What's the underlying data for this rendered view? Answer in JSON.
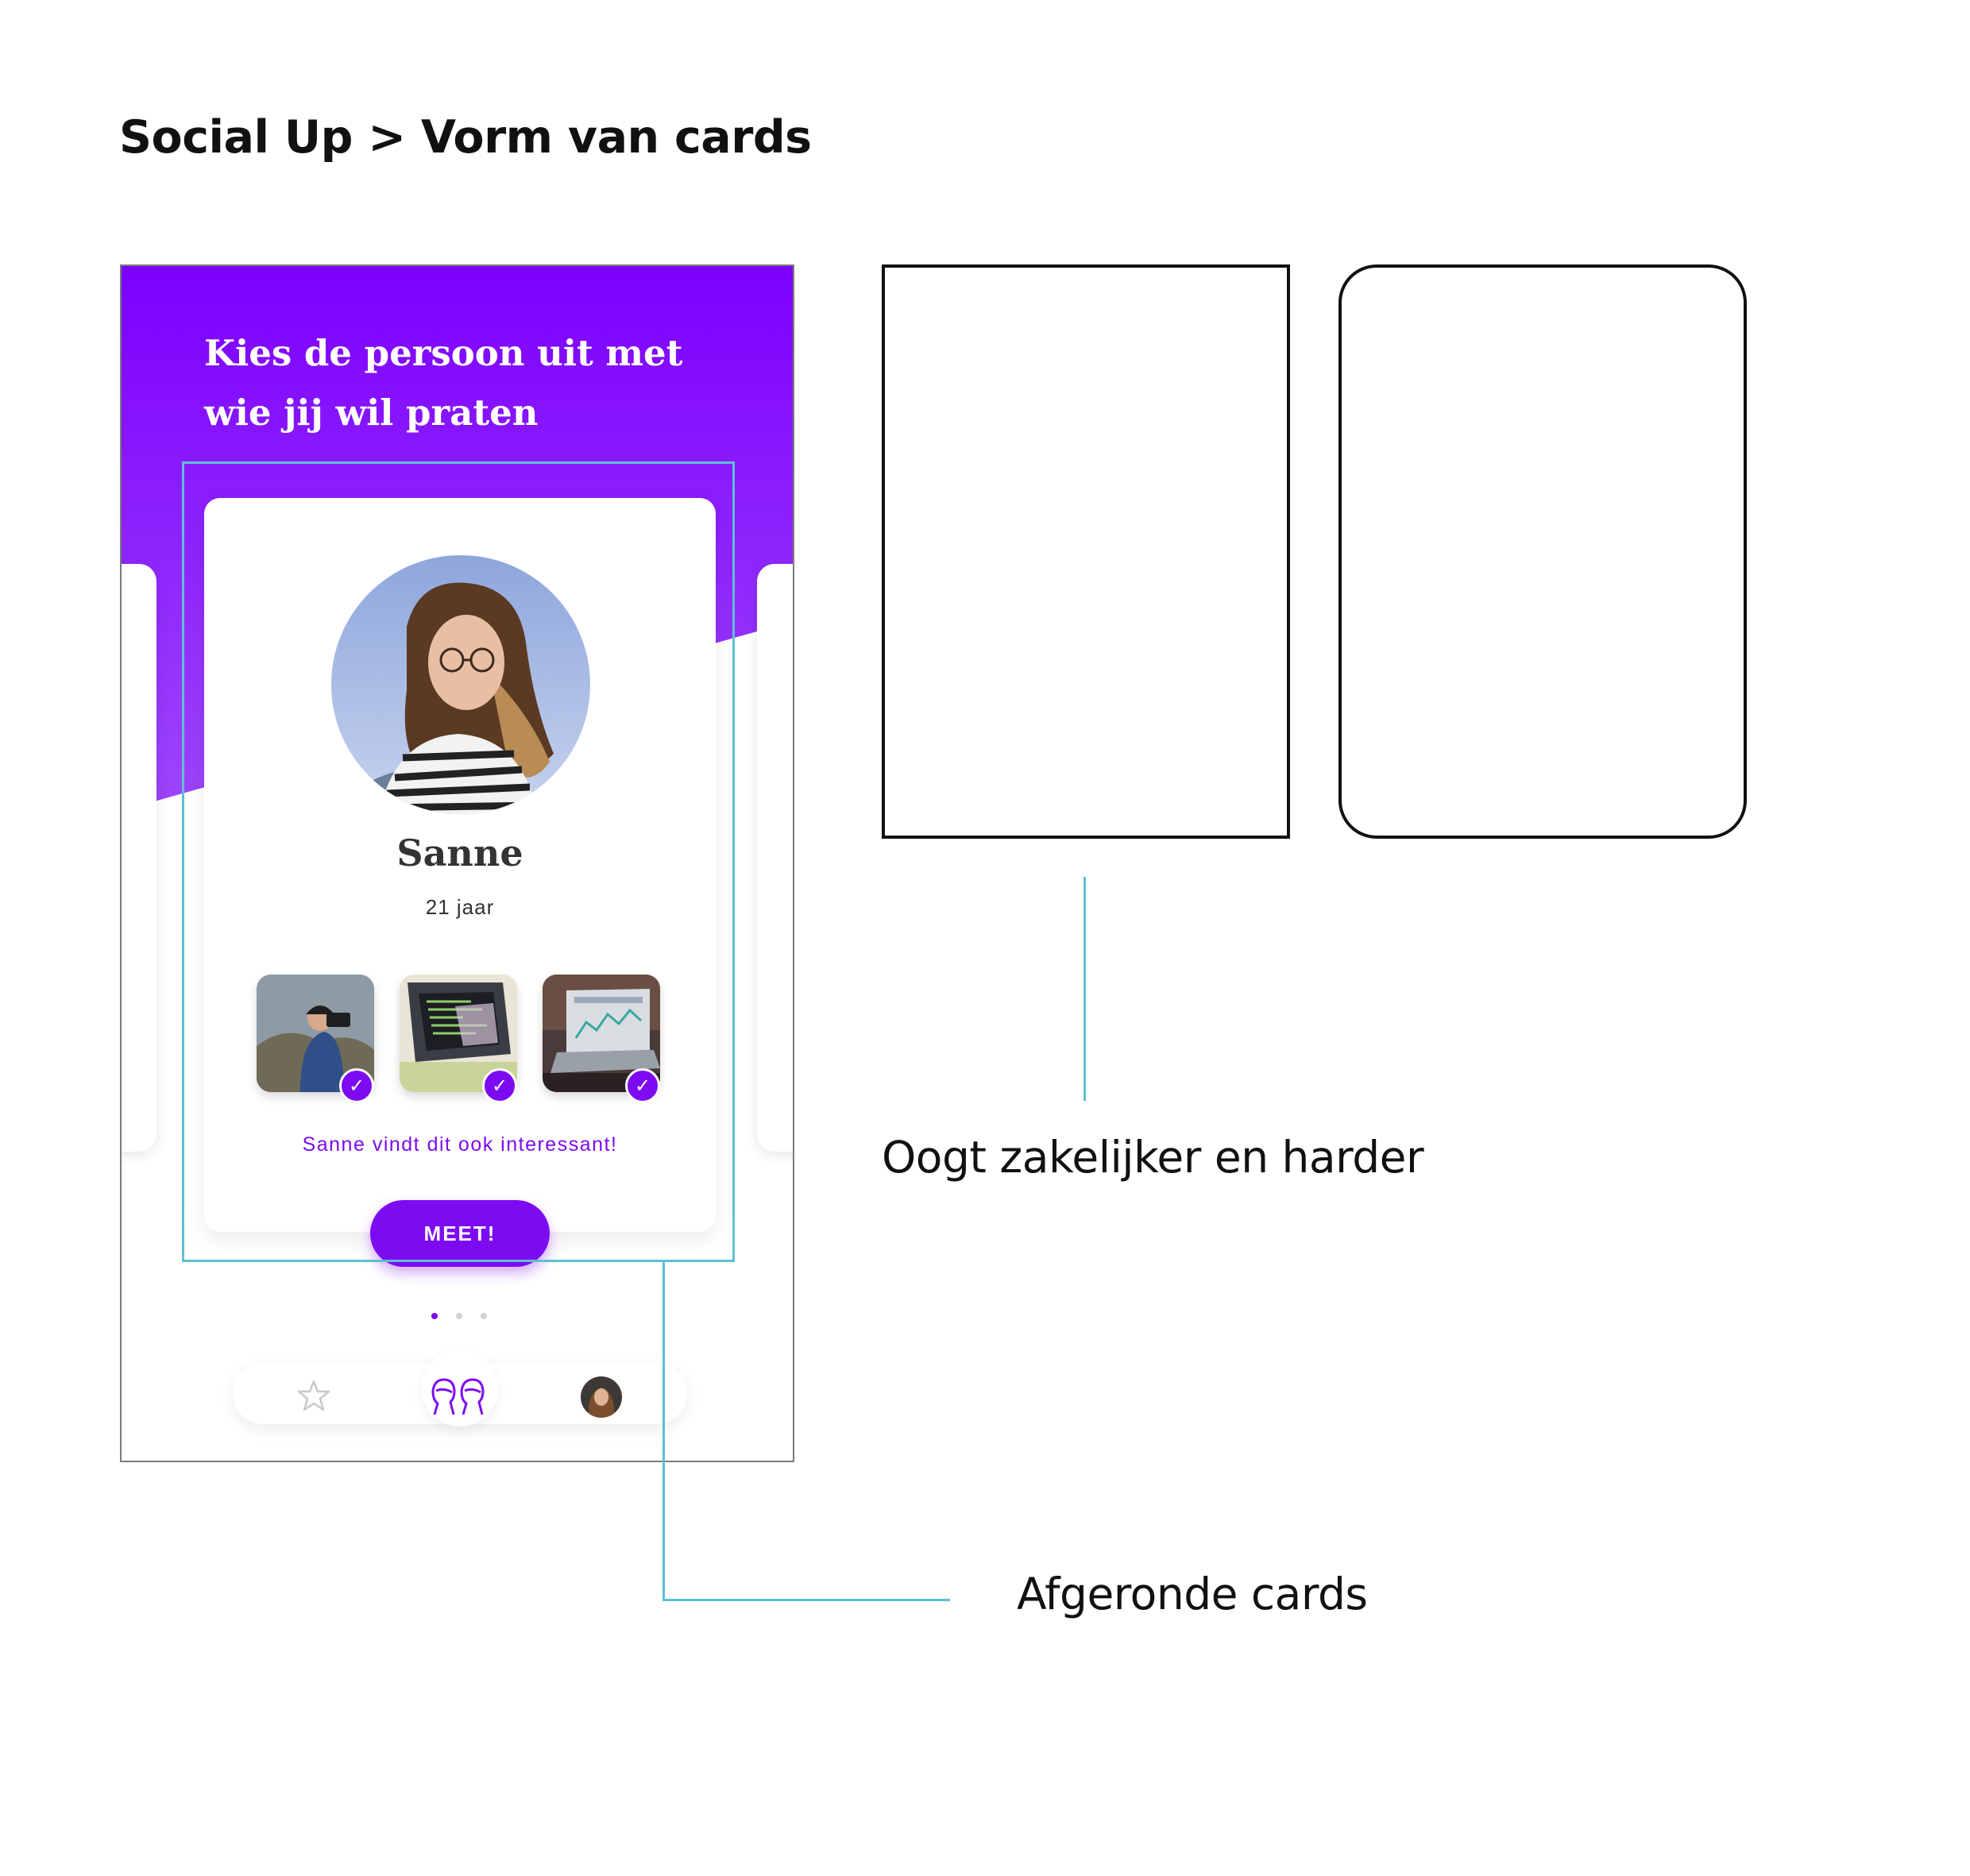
{
  "page_title": "Social Up > Vorm van cards",
  "app": {
    "prompt_line1": "Kies de persoon uit met",
    "prompt_line2": "wie jij wil praten",
    "profile": {
      "name": "Sanne",
      "age": "21 jaar",
      "interests": [
        {
          "icon": "photographer-photo",
          "checked": true
        },
        {
          "icon": "laptop-code-photo",
          "checked": true
        },
        {
          "icon": "laptop-dashboard-photo",
          "checked": true
        }
      ],
      "mutual_text": "Sanne vindt dit ook interessant!",
      "meet_label": "MEET!"
    },
    "pagination": {
      "pages": 3,
      "active": 1
    },
    "nav": {
      "items": [
        "star-icon",
        "people-icon",
        "profile-avatar"
      ],
      "active": "people-icon"
    },
    "colors": {
      "accent": "#7d0bf2",
      "gradient_top": "#7d00ff",
      "gradient_bottom": "#9b3dfb",
      "annotation": "#5ec0d4"
    }
  },
  "annotations": {
    "square_label": "Oogt zakelijker en harder",
    "rounded_label": "Afgeronde cards"
  }
}
